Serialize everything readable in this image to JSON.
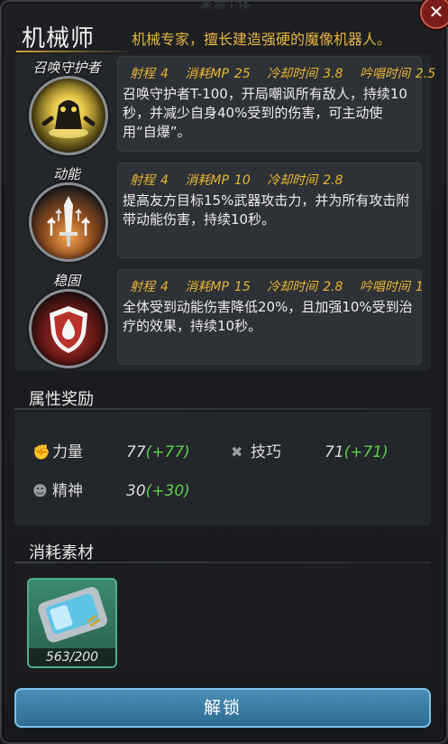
{
  "header": {
    "faded_title": "来源个体",
    "title": "机械师",
    "subtitle": "机械专家，擅长建造强硬的魔像机器人。",
    "close_icon": "close-icon"
  },
  "skills": [
    {
      "name": "召唤守护者",
      "icon": "summon-guardian-icon",
      "range_label": "射程",
      "range": "4",
      "mp_label": "消耗MP",
      "mp": "25",
      "cooldown_label": "冷却时间",
      "cooldown": "3.8",
      "cast_label": "吟唱时间",
      "cast": "2.5",
      "description": "召唤守护者T-100，开局嘲讽所有敌人，持续10秒，并减少自身40%受到的伤害，可主动使用“自爆”。"
    },
    {
      "name": "动能",
      "icon": "kinetic-sword-icon",
      "range_label": "射程",
      "range": "4",
      "mp_label": "消耗MP",
      "mp": "10",
      "cooldown_label": "冷却时间",
      "cooldown": "2.8",
      "description": "提高友方目标15%武器攻击力，并为所有攻击附带动能伤害，持续10秒。"
    },
    {
      "name": "稳固",
      "icon": "shield-drop-icon",
      "range_label": "射程",
      "range": "4",
      "mp_label": "消耗MP",
      "mp": "15",
      "cooldown_label": "冷却时间",
      "cooldown": "2.8",
      "cast_label": "吟唱时间",
      "cast": "1",
      "description": "全体受到动能伤害降低20%，且加强10%受到治疗的效果，持续10秒。"
    }
  ],
  "attributes": {
    "title": "属性奖励",
    "items": [
      {
        "icon": "fist-icon",
        "label": "力量",
        "value": "77",
        "bonus": "(+77)"
      },
      {
        "icon": "wrench-icon",
        "label": "技巧",
        "value": "71",
        "bonus": "(+71)"
      },
      {
        "icon": "head-icon",
        "label": "精神",
        "value": "30",
        "bonus": "(+30)"
      }
    ]
  },
  "materials": {
    "title": "消耗素材",
    "items": [
      {
        "icon": "data-chip-icon",
        "count": "563/200"
      }
    ]
  },
  "unlock_button": "解锁",
  "colors": {
    "accent_gold": "#e4b640",
    "bonus_green": "#5ccf4a",
    "button_blue": "#3b7ea6"
  }
}
